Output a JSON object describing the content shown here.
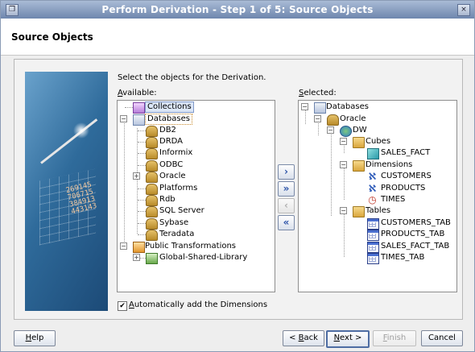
{
  "window": {
    "title": "Perform Derivation - Step 1 of 5: Source Objects",
    "close_glyph": "×",
    "restore_glyph": "❐"
  },
  "header": {
    "title": "Source Objects"
  },
  "intro_text": "Select the objects for the Derivation.",
  "available": {
    "label_mnemonic": "A",
    "label_rest": "vailable:",
    "items": [
      {
        "label": "Collections",
        "icon": "collections-icon",
        "state": "selected"
      },
      {
        "label": "Databases",
        "icon": "databases-icon",
        "state": "focused"
      },
      {
        "label": "DB2",
        "icon": "database-icon"
      },
      {
        "label": "DRDA",
        "icon": "database-icon"
      },
      {
        "label": "Informix",
        "icon": "database-icon"
      },
      {
        "label": "ODBC",
        "icon": "database-icon"
      },
      {
        "label": "Oracle",
        "icon": "database-icon"
      },
      {
        "label": "Platforms",
        "icon": "database-icon"
      },
      {
        "label": "Rdb",
        "icon": "database-icon"
      },
      {
        "label": "SQL Server",
        "icon": "database-icon"
      },
      {
        "label": "Sybase",
        "icon": "database-icon"
      },
      {
        "label": "Teradata",
        "icon": "database-icon"
      },
      {
        "label": "Public Transformations",
        "icon": "public-transformations-icon"
      },
      {
        "label": "Global-Shared-Library",
        "icon": "library-icon"
      }
    ]
  },
  "selected": {
    "label_mnemonic": "S",
    "label_rest": "elected:",
    "items": [
      {
        "label": "Databases",
        "icon": "databases-icon"
      },
      {
        "label": "Oracle",
        "icon": "database-icon"
      },
      {
        "label": "DW",
        "icon": "module-icon"
      },
      {
        "label": "Cubes",
        "icon": "folder-icon"
      },
      {
        "label": "SALES_FACT",
        "icon": "cube-icon"
      },
      {
        "label": "Dimensions",
        "icon": "folder-icon"
      },
      {
        "label": "CUSTOMERS",
        "icon": "dimension-icon"
      },
      {
        "label": "PRODUCTS",
        "icon": "dimension-icon"
      },
      {
        "label": "TIMES",
        "icon": "time-dimension-icon"
      },
      {
        "label": "Tables",
        "icon": "folder-icon"
      },
      {
        "label": "CUSTOMERS_TAB",
        "icon": "table-icon"
      },
      {
        "label": "PRODUCTS_TAB",
        "icon": "table-icon"
      },
      {
        "label": "SALES_FACT_TAB",
        "icon": "table-icon"
      },
      {
        "label": "TIMES_TAB",
        "icon": "table-icon"
      }
    ]
  },
  "shuttle": {
    "move": "›",
    "move_all": "»",
    "remove": "‹",
    "remove_all": "«"
  },
  "checkbox": {
    "mnemonic": "A",
    "rest": "utomatically add the Dimensions",
    "checked": true,
    "mark": "✔"
  },
  "buttons": {
    "help": {
      "mnemonic": "H",
      "rest": "elp"
    },
    "back": {
      "prefix": "< ",
      "mnemonic": "B",
      "rest": "ack"
    },
    "next": {
      "mnemonic": "N",
      "rest": "ext >"
    },
    "finish": {
      "mnemonic": "F",
      "rest": "inish"
    },
    "cancel": "Cancel"
  }
}
